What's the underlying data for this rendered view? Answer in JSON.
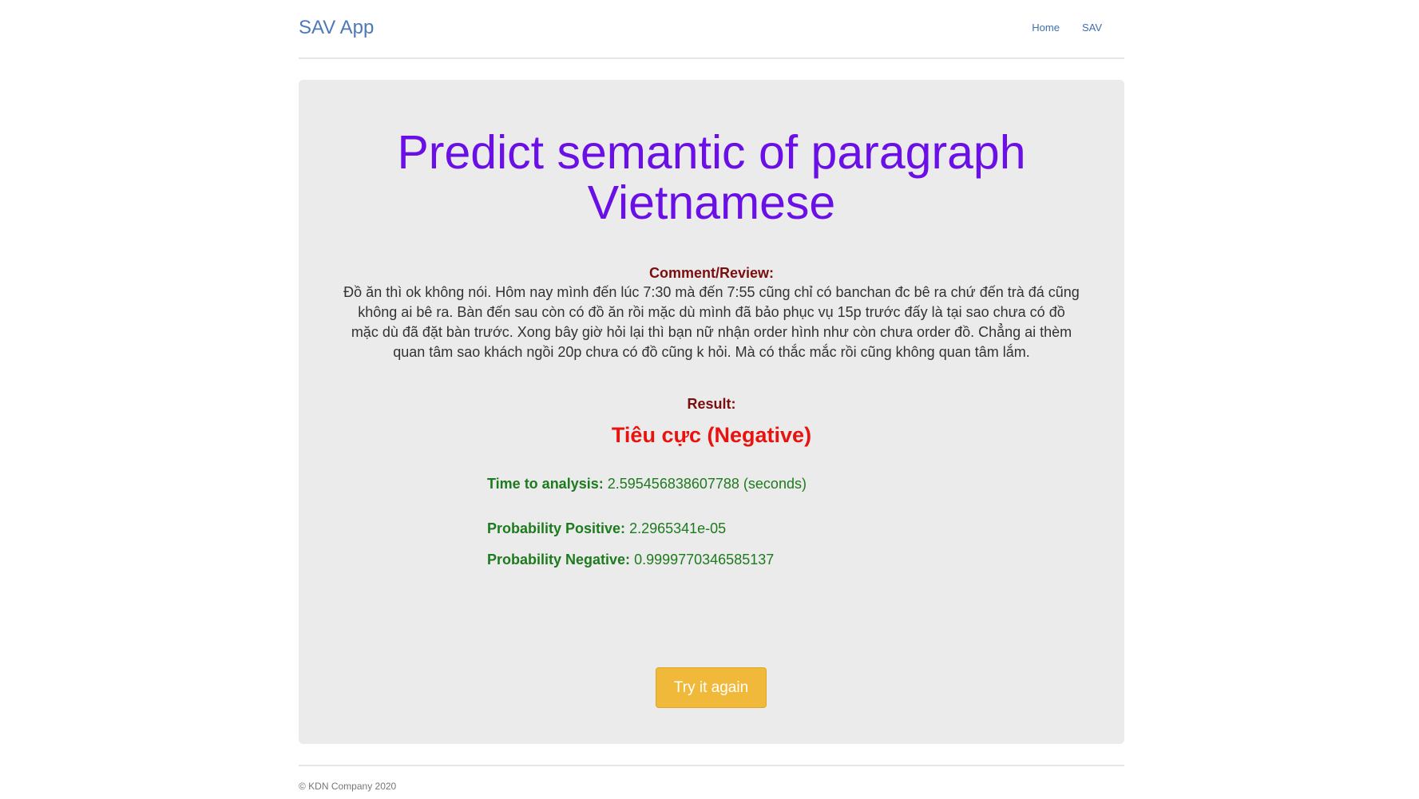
{
  "header": {
    "brand": "SAV App",
    "nav": [
      {
        "label": "Home"
      },
      {
        "label": "SAV"
      }
    ]
  },
  "main": {
    "title_line1": "Predict semantic of paragraph",
    "title_line2": "Vietnamese",
    "comment_label": "Comment/Review:",
    "comment_text": "Đồ ăn thì ok không nói. Hôm nay mình đến lúc 7:30 mà đến 7:55 cũng chỉ có banchan đc bê ra chứ đến trà đá cũng không ai bê ra. Bàn đến sau còn có đồ ăn rồi mặc dù mình đã bảo phục vụ 15p trước đấy là tại sao chưa có đồ mặc dù đã đặt bàn trước. Xong bây giờ hỏi lại thì bạn nữ nhận order hình như còn chưa order đồ. Chẳng ai thèm quan tâm sao khách ngồi 20p chưa có đồ cũng k hỏi. Mà có thắc mắc rồi cũng không quan tâm lắm.",
    "result_label": "Result:",
    "result_value": "Tiêu cực (Negative)",
    "time_label": "Time to analysis:",
    "time_value": "2.595456838607788 (seconds)",
    "prob_pos_label": "Probability Positive:",
    "prob_pos_value": "2.2965341e-05",
    "prob_neg_label": "Probability Negative:",
    "prob_neg_value": "0.9999770346585137",
    "button_label": "Try it again"
  },
  "footer": {
    "text": "© KDN Company 2020"
  },
  "colors": {
    "title": "#6a0fe6",
    "label": "#7a0e0e",
    "result": "#e8130e",
    "stats": "#1e7a1e",
    "button": "#f0b93a",
    "brand": "#4e79b8"
  }
}
